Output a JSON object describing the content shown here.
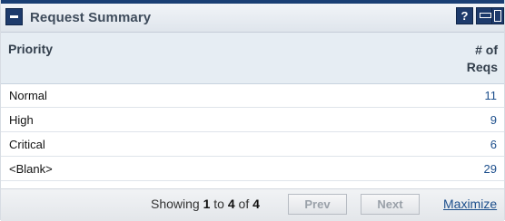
{
  "panel": {
    "title": "Request Summary",
    "help_symbol": "?"
  },
  "table": {
    "headers": {
      "priority": "Priority",
      "count_line1": "# of",
      "count_line2": "Reqs"
    },
    "rows": [
      {
        "priority": "Normal",
        "count": "11"
      },
      {
        "priority": "High",
        "count": "9"
      },
      {
        "priority": "Critical",
        "count": "6"
      },
      {
        "priority": "<Blank>",
        "count": "29"
      }
    ]
  },
  "footer": {
    "showing_prefix": "Showing ",
    "start": "1",
    "to": " to ",
    "end": "4",
    "of": " of ",
    "total": "4",
    "prev_label": "Prev",
    "next_label": "Next",
    "maximize_label": "Maximize"
  },
  "colors": {
    "title_bar_top": "#1a3f74",
    "link": "#1d4f8c",
    "header_bg": "#e6edf3"
  },
  "icons": [
    "collapse-icon",
    "help-icon",
    "minimize-icon",
    "restore-icon"
  ]
}
